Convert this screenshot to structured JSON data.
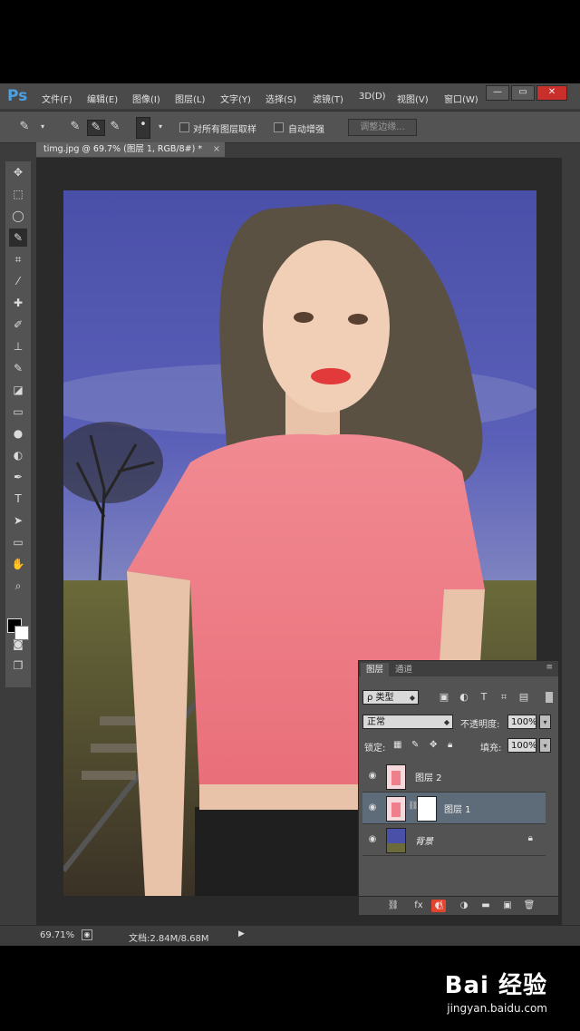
{
  "app": {
    "logo": "Ps"
  },
  "menu": [
    "文件(F)",
    "编辑(E)",
    "图像(I)",
    "图层(L)",
    "文字(Y)",
    "选择(S)",
    "滤镜(T)",
    "3D(D)",
    "视图(V)",
    "窗口(W)"
  ],
  "window_buttons": {
    "minimize": "—",
    "restore": "▭",
    "close": "✕"
  },
  "options": {
    "sample_all_layers": "对所有图层取样",
    "auto_enhance": "自动增强",
    "refine_edge": "调整边缘..."
  },
  "document": {
    "tab_title": "timg.jpg @ 69.7% (图层 1, RGB/8#) *",
    "close": "×"
  },
  "status": {
    "zoom": "69.71%",
    "doc_size": "文档:2.84M/8.68M"
  },
  "layers_panel": {
    "tabs": [
      "图层",
      "通道"
    ],
    "filter_kind": "ρ 类型",
    "blend_mode": "正常",
    "opacity_label": "不透明度:",
    "opacity_value": "100%",
    "lock_label": "锁定:",
    "fill_label": "填充:",
    "fill_value": "100%",
    "layers": [
      {
        "name": "图层 2",
        "selected": false
      },
      {
        "name": "图层 1",
        "selected": true
      },
      {
        "name": "背景",
        "selected": false,
        "locked": true
      }
    ],
    "footer_icons": [
      "link-icon",
      "fx-icon",
      "mask-icon",
      "adjustment-icon",
      "folder-icon",
      "new-layer-icon",
      "trash-icon"
    ],
    "fx_label": "fx"
  },
  "watermark": {
    "brand": "Bai 经验",
    "url": "jingyan.baidu.com"
  },
  "colors": {
    "ui_dark": "#3c3c3c",
    "panel": "#535353",
    "selected_layer": "#5e6b78",
    "ps_blue": "#4ca0e0"
  }
}
